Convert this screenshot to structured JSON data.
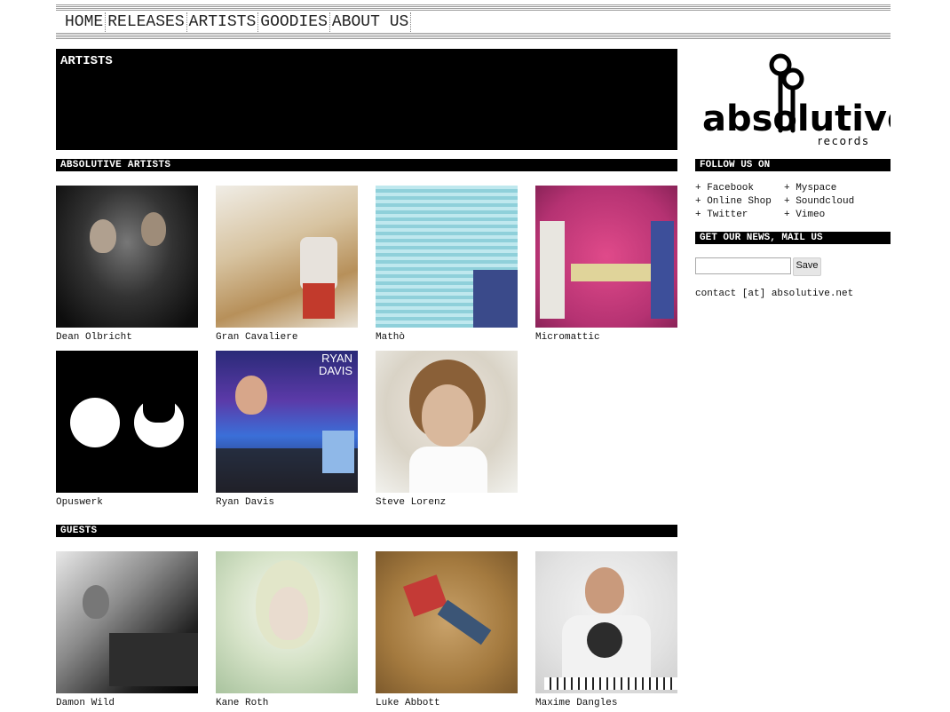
{
  "nav": {
    "items": [
      "HOME",
      "RELEASES",
      "ARTISTS",
      "GOODIES",
      "ABOUT US"
    ]
  },
  "hero": {
    "title": "ARTISTS"
  },
  "sections": {
    "artists_title": "ABSOLUTIVE ARTISTS",
    "guests_title": "GUESTS"
  },
  "artists": [
    {
      "name": "Dean Olbricht"
    },
    {
      "name": "Gran Cavaliere"
    },
    {
      "name": "Mathò"
    },
    {
      "name": "Micromattic"
    },
    {
      "name": "Opuswerk"
    },
    {
      "name": "Ryan Davis"
    },
    {
      "name": "Steve Lorenz"
    }
  ],
  "guests": [
    {
      "name": "Damon Wild"
    },
    {
      "name": "Kane Roth"
    },
    {
      "name": "Luke Abbott"
    },
    {
      "name": "Maxime Dangles"
    }
  ],
  "sidebar": {
    "logo_text": "absolutive",
    "logo_sub": "records",
    "follow_title": "FOLLOW US ON",
    "follow_links_left": [
      "+ Facebook",
      "+ Online Shop",
      "+ Twitter"
    ],
    "follow_links_right": [
      "+ Myspace",
      "+ Soundcloud",
      "+ Vimeo"
    ],
    "news_title": "GET OUR NEWS, MAIL US",
    "news_input_value": "",
    "save_label": "Save",
    "contact": "contact [at] absolutive.net"
  },
  "thumb_texts": {
    "ryan_davis_label": "RYAN DAVIS"
  }
}
